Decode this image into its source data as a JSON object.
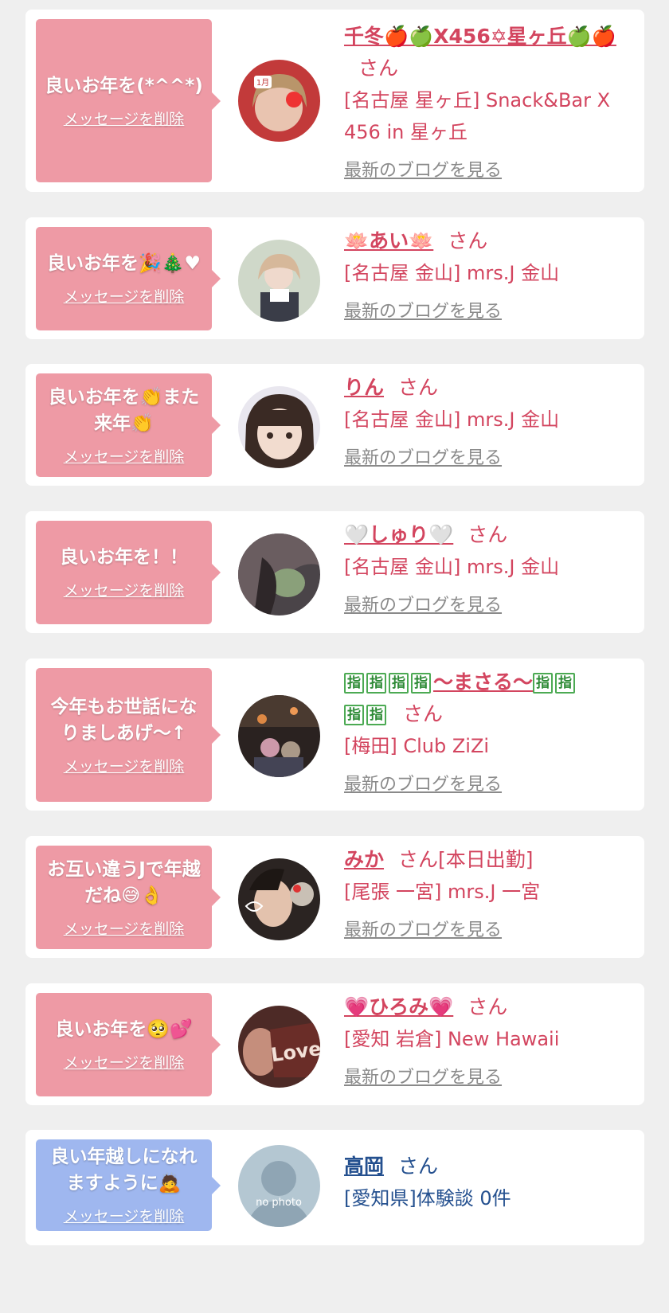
{
  "messages": [
    {
      "message": "良いお年を(*^^*)",
      "delete_label": "メッセージを削除",
      "name": "千冬🍎🍏X456✡星ヶ丘🍏🍎",
      "san": "さん",
      "status": "",
      "shop": "[名古屋 星ヶ丘] Snack&Bar X 456 in 星ヶ丘",
      "blog_label": "最新のブログを見る"
    },
    {
      "message": "良いお年を🎉🎄♥",
      "delete_label": "メッセージを削除",
      "name": "🪷あい🪷",
      "san": "さん",
      "status": "",
      "shop": "[名古屋 金山] mrs.J 金山",
      "blog_label": "最新のブログを見る"
    },
    {
      "message": "良いお年を👏また来年👏",
      "delete_label": "メッセージを削除",
      "name": "りん",
      "san": "さん",
      "status": "",
      "shop": "[名古屋 金山] mrs.J 金山",
      "blog_label": "最新のブログを見る"
    },
    {
      "message": "良いお年を！！",
      "delete_label": "メッセージを削除",
      "name": "🤍しゅり🤍",
      "san": "さん",
      "status": "",
      "shop": "[名古屋 金山] mrs.J 金山",
      "blog_label": "最新のブログを見る"
    },
    {
      "message": "今年もお世話になりましあげ〜↑",
      "delete_label": "メッセージを削除",
      "name_prefix": "指指指指",
      "name": "〜まさる〜",
      "name_suffix": "指指指指",
      "san": "さん",
      "status": "",
      "shop": "[梅田] Club ZiZi",
      "blog_label": "最新のブログを見る"
    },
    {
      "message": "お互い違うJで年越だね😅👌",
      "delete_label": "メッセージを削除",
      "name": "みか",
      "san": "さん",
      "status": "[本日出勤]",
      "shop": "[尾張 一宮] mrs.J 一宮",
      "blog_label": "最新のブログを見る"
    },
    {
      "message": "良いお年を🥺💕",
      "delete_label": "メッセージを削除",
      "name": "💗ひろみ💗",
      "san": "さん",
      "status": "",
      "shop": "[愛知 岩倉] New Hawaii",
      "blog_label": "最新のブログを見る"
    },
    {
      "message": "良い年越しになれますように🙇",
      "delete_label": "メッセージを削除",
      "name": "高岡",
      "san": "さん",
      "status": "",
      "shop": "[愛知県]体験談 0件",
      "blog_label": "",
      "avatar_text": "no photo"
    }
  ],
  "avatar_overlays": {
    "first_month_tag": "1月",
    "love_text": "Love"
  },
  "colors": {
    "bubble_pink": "#ee9aa5",
    "bubble_blue": "#9fb7ef",
    "name_pink": "#d3455f",
    "name_blue": "#24508f",
    "blog_gray": "#8a8a8a",
    "page_bg": "#efefef"
  }
}
